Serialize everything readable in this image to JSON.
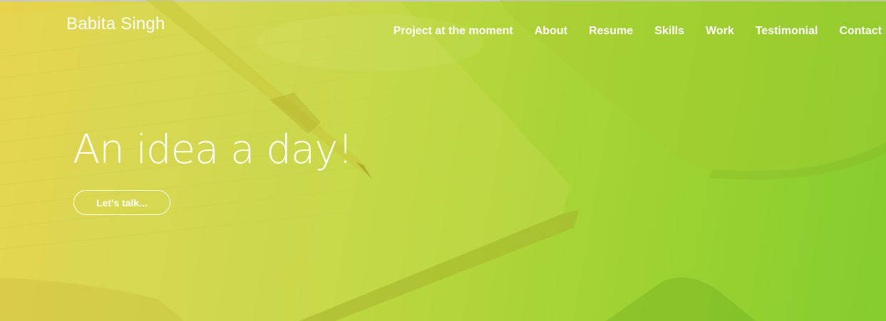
{
  "header": {
    "brand": "Babita Singh"
  },
  "nav": {
    "items": [
      {
        "label": "Project at the moment"
      },
      {
        "label": "About"
      },
      {
        "label": "Resume"
      },
      {
        "label": "Skills"
      },
      {
        "label": "Work"
      },
      {
        "label": "Testimonial"
      },
      {
        "label": "Contact"
      }
    ]
  },
  "hero": {
    "headline": "An idea a day!",
    "cta_label": "Let's talk..."
  },
  "colors": {
    "gradient_start": "#e9d34a",
    "gradient_end": "#85cc2e",
    "text": "#ffffff"
  }
}
